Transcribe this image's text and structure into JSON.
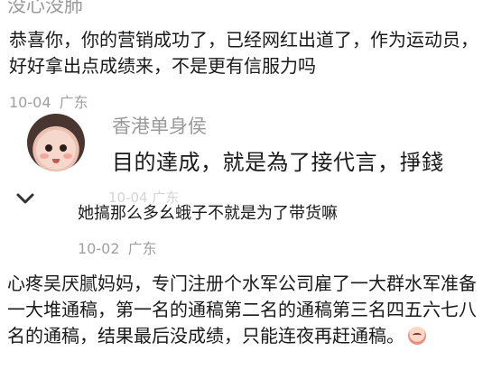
{
  "comments": [
    {
      "username": "没心没肺",
      "text": "恭喜你，你的营销成功了，已经网红出道了，作为运动员，好好拿出点成绩来，不是更有信服力吗",
      "date": "10-04",
      "location": "广东"
    },
    {
      "username": "香港单身侯",
      "quote": "目的達成，就是為了接代言，掙錢",
      "overlapped_meta": "10-04 广东",
      "reply_text": "她搞那么多幺蛾子不就是为了带货嘛",
      "date": "10-02",
      "location": "广东"
    },
    {
      "text": "心疼吴厌腻妈妈，专门注册个水军公司雇了一大群水军准备一大堆通稿，第一名的通稿第二名的通稿第三名四五六七八名的通稿，结果最后没成绩，只能连夜再赶通稿。"
    }
  ],
  "icons": {
    "collapse": "chevron-down-icon",
    "emoji": "emoji-face-icon"
  }
}
